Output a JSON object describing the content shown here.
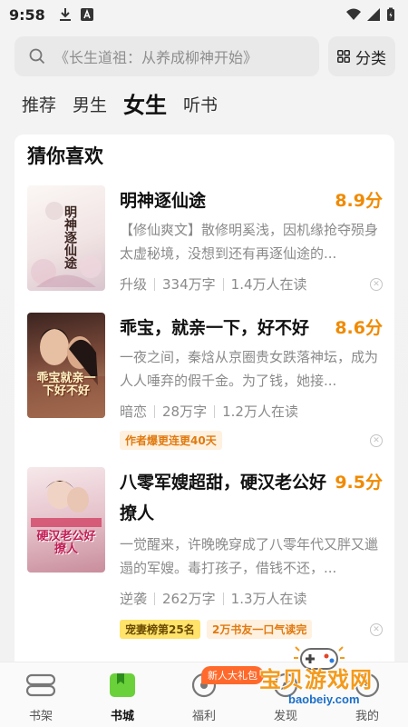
{
  "status_bar": {
    "time": "9:58"
  },
  "search": {
    "placeholder": "《长生道祖：从养成柳神开始》",
    "category_label": "分类"
  },
  "tabs": [
    {
      "label": "推荐"
    },
    {
      "label": "男生"
    },
    {
      "label": "女生",
      "active": true
    },
    {
      "label": "听书"
    }
  ],
  "section": {
    "title": "猜你喜欢"
  },
  "books": [
    {
      "title": "明神逐仙途",
      "score": "8.9分",
      "desc": "【修仙爽文】散修明奚浅，因机缘抢夺殒身太虚秘境，没想到还有再逐仙途的...",
      "genre": "升级",
      "words": "334万字",
      "readers": "1.4万人在读",
      "cover_text": "明神逐仙途"
    },
    {
      "title": "乖宝，就亲一下，好不好",
      "score": "8.6分",
      "desc": "一夜之间，秦焓从京圈贵女跌落神坛，成为人人唾弃的假千金。为了钱，她接...",
      "genre": "暗恋",
      "words": "28万字",
      "readers": "1.2万人在读",
      "tags": [
        "作者爆更连更40天"
      ],
      "cover_text": "乖宝就亲一下好不好"
    },
    {
      "title": "八零军嫂超甜，硬汉老公好撩人",
      "score": "9.5分",
      "desc": "一觉醒来，许晚晚穿成了八零年代又胖又邋遢的军嫂。毒打孩子，借钱不还，...",
      "genre": "逆袭",
      "words": "262万字",
      "readers": "1.3万人在读",
      "tags": [
        "宠妻榜第25名",
        "2万书友一口气读完"
      ],
      "cover_text": "硬汉老公好撩人"
    }
  ],
  "bottom_nav": [
    {
      "label": "书架"
    },
    {
      "label": "书城",
      "active": true
    },
    {
      "label": "福利"
    },
    {
      "label": "发现"
    },
    {
      "label": "我的"
    }
  ],
  "promo": {
    "label": "新人大礼包"
  },
  "watermark": {
    "text": "宝贝游戏网",
    "url": "baobeiy.com"
  },
  "colors": {
    "accent": "#f08a00",
    "nav_active": "#6bd13a"
  },
  "icons": [
    "download-icon",
    "a-icon",
    "wifi-icon",
    "battery-icon",
    "search-icon",
    "grid-icon",
    "close-icon",
    "bookshelf-icon",
    "bookstore-icon",
    "gift-icon",
    "discover-icon",
    "profile-icon"
  ]
}
